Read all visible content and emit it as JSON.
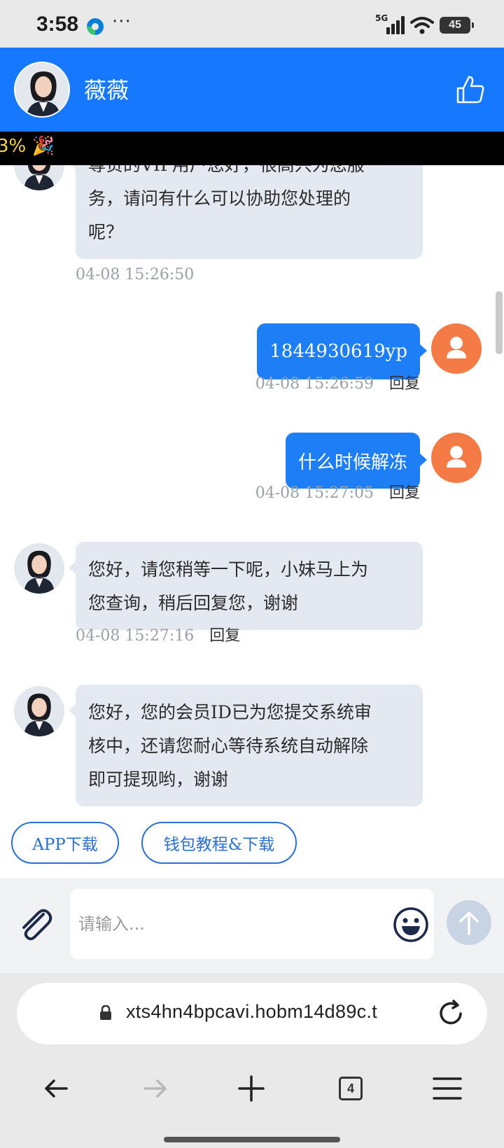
{
  "status_bar": {
    "time": "3:58",
    "more": "···",
    "network": "5G",
    "battery": "45"
  },
  "header": {
    "contact_name": "薇薇"
  },
  "ticker": {
    "text": "3% 🎉"
  },
  "messages": [
    {
      "from": "agent",
      "text_lines": [
        "尊贵的VIP用户您好，很高兴为您服",
        "务，请问有什么可以协助您处理的",
        "呢？"
      ],
      "time": "04-08 15:26:50",
      "reply": ""
    },
    {
      "from": "user",
      "text": "1844930619yp",
      "time": "04-08 15:26:59",
      "reply": "回复"
    },
    {
      "from": "user",
      "text": "什么时候解冻",
      "time": "04-08 15:27:05",
      "reply": "回复"
    },
    {
      "from": "agent",
      "text_lines": [
        "您好，请您稍等一下呢，小妹马上为",
        "您查询，稍后回复您，谢谢"
      ],
      "time": "04-08 15:27:16",
      "reply": "回复"
    },
    {
      "from": "agent",
      "text_lines": [
        "您好，您的会员ID已为您提交系统审",
        "核中，还请您耐心等待系统自动解除",
        "即可提现哟，谢谢"
      ],
      "time": "",
      "reply": ""
    }
  ],
  "quick_actions": [
    "APP下载",
    "钱包教程&下载"
  ],
  "input": {
    "placeholder": "请输入..."
  },
  "browser": {
    "url": "xts4hn4bpcavi.hobm14d89c.t",
    "tab_count": "4"
  },
  "colors": {
    "header": "#1677ff",
    "user_bubble": "#1e7ef6",
    "agent_bubble": "#e4e9f1",
    "user_avatar": "#f47b45",
    "quick_button": "#2a6fd6"
  },
  "icons": [
    "edge-browser-icon",
    "signal-icon",
    "wifi-icon",
    "battery-icon",
    "thumbs-up-icon",
    "paperclip-icon",
    "emoji-icon",
    "send-arrow-icon",
    "lock-icon",
    "reload-icon",
    "back-arrow-icon",
    "forward-arrow-icon",
    "new-tab-plus-icon",
    "tabs-icon",
    "menu-icon"
  ]
}
